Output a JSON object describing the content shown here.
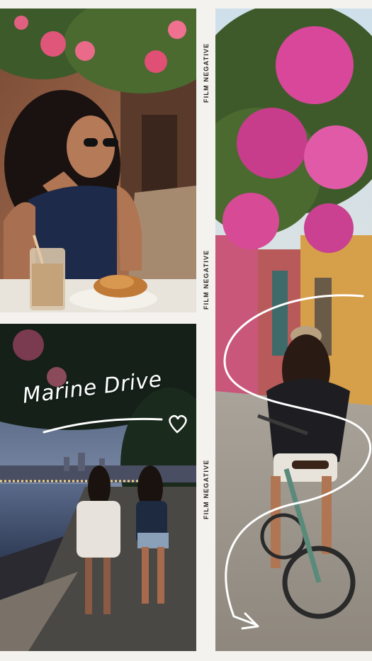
{
  "labels": {
    "film_1": "FILM NEGATIVE",
    "film_2": "FILM NEGATIVE",
    "film_3": "FILM NEGATIVE"
  },
  "caption": "Marine Drive",
  "photos": [
    {
      "name": "cafe-woman-croissant"
    },
    {
      "name": "bougainvillea-street-bike"
    },
    {
      "name": "marine-drive-night-walk"
    }
  ],
  "colors": {
    "page_bg": "#f4f2ee",
    "label_text": "#2a2622",
    "doodle": "#ffffff"
  }
}
